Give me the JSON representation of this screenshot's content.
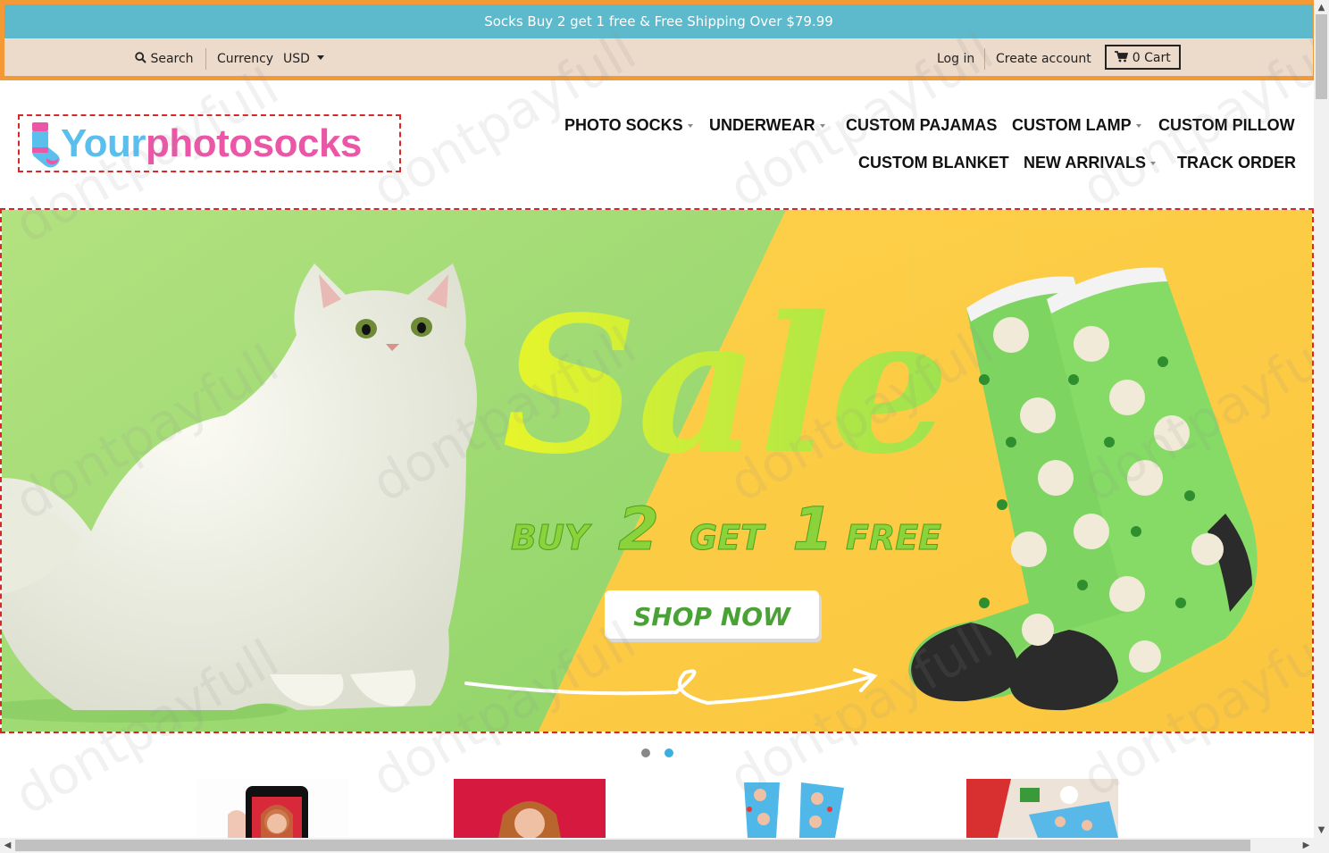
{
  "promo": {
    "text": "Socks Buy 2 get 1 free & Free Shipping Over $79.99"
  },
  "utility": {
    "search_label": "Search",
    "currency_label": "Currency",
    "currency_value": "USD",
    "login_label": "Log in",
    "create_account_label": "Create account",
    "cart_label": "0 Cart"
  },
  "logo": {
    "part1": "Your",
    "part2": "photosocks"
  },
  "nav": {
    "photo_socks": "PHOTO SOCKS",
    "underwear": "UNDERWEAR",
    "custom_pajamas": "CUSTOM PAJAMAS",
    "custom_lamp": "CUSTOM LAMP",
    "custom_pillow": "CUSTOM PILLOW",
    "custom_blanket": "CUSTOM BLANKET",
    "new_arrivals": "NEW ARRIVALS",
    "track_order": "TRACK ORDER"
  },
  "hero": {
    "headline": "Sale",
    "w_buy": "BUY",
    "w_2": "2",
    "w_get": "GET",
    "w_1": "1",
    "w_free": "FREE",
    "cta": "SHOP NOW"
  },
  "slider": {
    "slide_count": 2,
    "active_index": 1
  },
  "watermark": "dontpayfull",
  "colors": {
    "promo_bg": "#5db9cc",
    "utility_bg": "#ecdaca",
    "frame_orange": "#f39a36",
    "logo_blue": "#5bbfee",
    "logo_pink": "#ec56a7",
    "hero_green": "#a6dd78",
    "hero_yellow": "#fccd45",
    "cta_text": "#4aa236",
    "dot_active": "#3bb0e0",
    "dot_inactive": "#888888"
  }
}
